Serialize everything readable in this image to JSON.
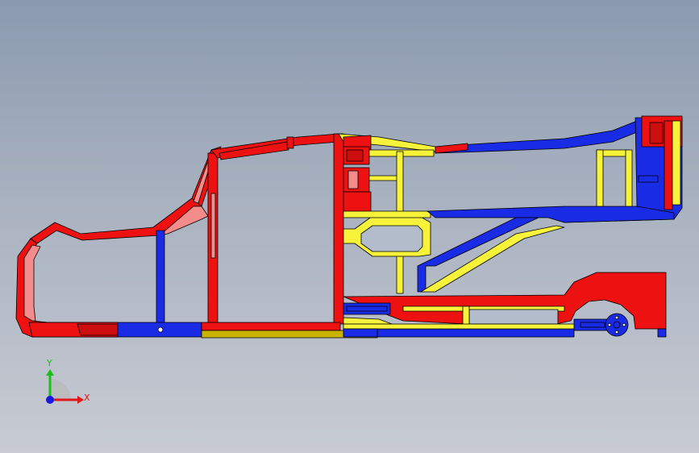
{
  "viewport": {
    "background_top": "#8b9ab0",
    "background_bottom": "#c8cbd3"
  },
  "colors": {
    "red": "#ee1111",
    "light_red": "#f58c8c",
    "blue": "#1a2be6",
    "yellow": "#f7f23a",
    "olive": "#c9b200",
    "outline": "#000000"
  },
  "model": {
    "name_icon": "chassis-frame-model"
  },
  "triad": {
    "x_label": "X",
    "y_label": "Y",
    "x_color": "#e01818",
    "y_color": "#18c018",
    "z_color": "#1818e0"
  }
}
